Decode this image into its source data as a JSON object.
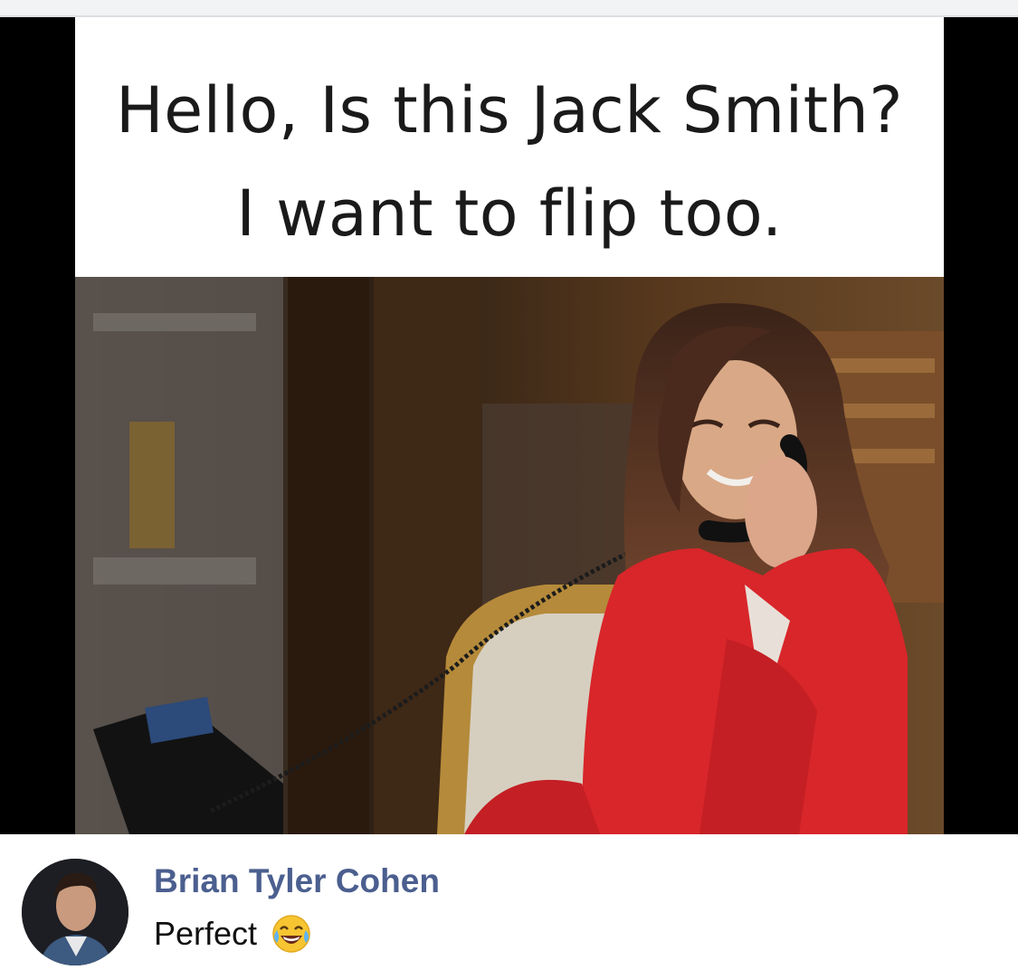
{
  "meme": {
    "caption_line1": "Hello, Is this Jack Smith?",
    "caption_line2": "I want to flip too."
  },
  "comment": {
    "author": "Brian Tyler Cohen",
    "text": "Perfect",
    "emoji": "face-with-tears-of-joy-icon"
  },
  "colors": {
    "author_link": "#4b5f8f",
    "dress_red": "#d8262a",
    "divider": "#dcdee3"
  }
}
